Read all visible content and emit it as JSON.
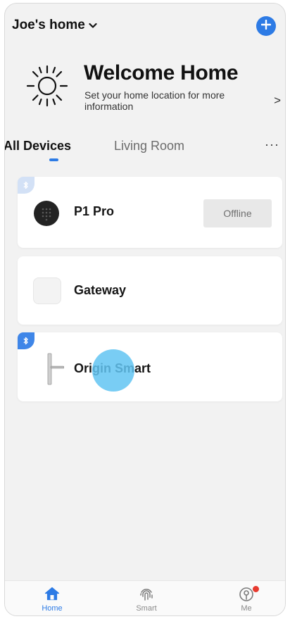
{
  "header": {
    "home_name": "Joe's home",
    "dropdown_icon": "chevron-down-icon",
    "add_icon": "plus-icon"
  },
  "welcome": {
    "title": "Welcome Home",
    "subtitle": "Set your home location for more information",
    "arrow": ">",
    "icon": "sun-icon"
  },
  "tabs": [
    {
      "label": "All Devices",
      "active": true
    },
    {
      "label": "Living Room",
      "active": false
    }
  ],
  "more_label": "···",
  "devices": [
    {
      "name": "P1 Pro",
      "status": "Offline",
      "bluetooth": true,
      "icon": "smart-lock-icon"
    },
    {
      "name": "Gateway",
      "bluetooth": false,
      "icon": "gateway-icon"
    },
    {
      "name": "Origin Smart",
      "bluetooth": true,
      "icon": "door-handle-icon"
    }
  ],
  "bottom_nav": [
    {
      "label": "Home",
      "icon": "home-icon",
      "active": true
    },
    {
      "label": "Smart",
      "icon": "fingerprint-icon",
      "active": false
    },
    {
      "label": "Me",
      "icon": "profile-icon",
      "active": false,
      "notification": true
    }
  ],
  "colors": {
    "accent": "#2d7be5",
    "background": "#f2f2f2",
    "card": "#ffffff",
    "offline_badge": "#e8e8e8",
    "notification": "#e73a2f"
  }
}
